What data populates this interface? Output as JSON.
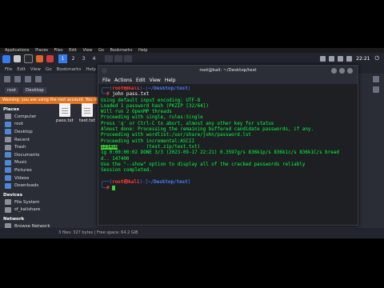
{
  "menu_strip": [
    "Applications",
    "Places",
    "Files",
    "Edit",
    "View",
    "Go",
    "Bookmarks",
    "Help"
  ],
  "panel": {
    "workspaces": [
      "1",
      "2",
      "3",
      "4"
    ],
    "active_workspace": "1",
    "clock": "22:21"
  },
  "file_manager": {
    "menubar": [
      "File",
      "Edit",
      "View",
      "Go",
      "Bookmarks",
      "Help"
    ],
    "path": [
      "root",
      "Desktop"
    ],
    "warning": "Warning: you are using the root account. You may",
    "places_header": "Places",
    "places": [
      "Computer",
      "root",
      "Desktop",
      "Recent",
      "Trash",
      "Documents",
      "Music",
      "Pictures",
      "Videos",
      "Downloads"
    ],
    "devices_header": "Devices",
    "devices": [
      "File System",
      "sf_kalishare"
    ],
    "network_header": "Network",
    "network": [
      "Browse Network"
    ],
    "files": [
      "pass.txt",
      "test.txt"
    ],
    "status": "3 files: 327 bytes | Free space: 64.2 GiB"
  },
  "terminal": {
    "title": "root@kali: ~/Desktop/test",
    "menu": [
      "File",
      "Actions",
      "Edit",
      "View",
      "Help"
    ],
    "prompt_user": "root㉿kali",
    "cwd": "~/Desktop/test",
    "command": "john pass.txt",
    "output": [
      "Using default input encoding: UTF-8",
      "Loaded 1 password hash (PKZIP [32/64])",
      "Will run 2 OpenMP threads",
      "Proceeding with single, rules:Single",
      "Press 'q' or Ctrl-C to abort, almost any other key for status",
      "Almost done: Processing the remaining buffered candidate passwords, if any.",
      "Proceeding with wordlist:/usr/share/john/password.lst",
      "Proceeding with incremental:ASCII"
    ],
    "cracked_password": "123456",
    "cracked_file": "(test.zip/test.txt)",
    "stats_line_1": "1g 0:00:00:02 DONE 3/3 (2023-09-17 22:21) 0.3597g/s 836k1p/s 836k1c/s 836k1C/s bread",
    "stats_line_2": "d.. 147400",
    "show_hint": "Use the \"--show\" option to display all of the cracked passwords reliably",
    "session": "Session completed."
  }
}
